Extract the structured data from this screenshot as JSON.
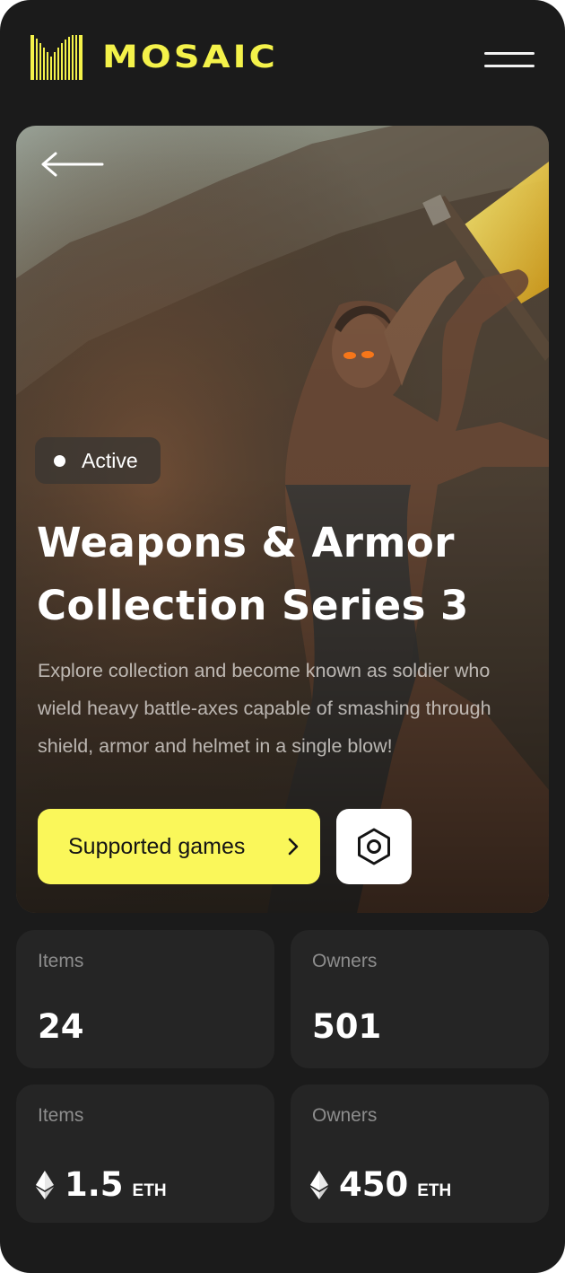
{
  "app": {
    "brand": "MOSAIC",
    "brand_color": "#f4f24a",
    "background": "#1b1b1b"
  },
  "header": {
    "logo_icon": "mosaic-logo-icon",
    "menu_icon": "hamburger-menu-icon"
  },
  "hero": {
    "back_icon": "arrow-left-icon",
    "status": "Active",
    "title": "Weapons & Armor Collection Series 3",
    "description": "Explore collection and become known as soldier who wield heavy battle-axes capable of smashing through shield, armor and helmet in a single blow!",
    "primary_button": "Supported games",
    "primary_button_icon": "chevron-right-icon",
    "primary_button_color": "#faf75a",
    "secondary_button_icon": "hexagon-settings-icon"
  },
  "stats": [
    {
      "label": "Items",
      "value": "24"
    },
    {
      "label": "Owners",
      "value": "501"
    },
    {
      "label": "Items",
      "value": "1.5",
      "unit": "ETH",
      "icon": "ethereum-icon"
    },
    {
      "label": "Owners",
      "value": "450",
      "unit": "ETH",
      "icon": "ethereum-icon"
    }
  ]
}
